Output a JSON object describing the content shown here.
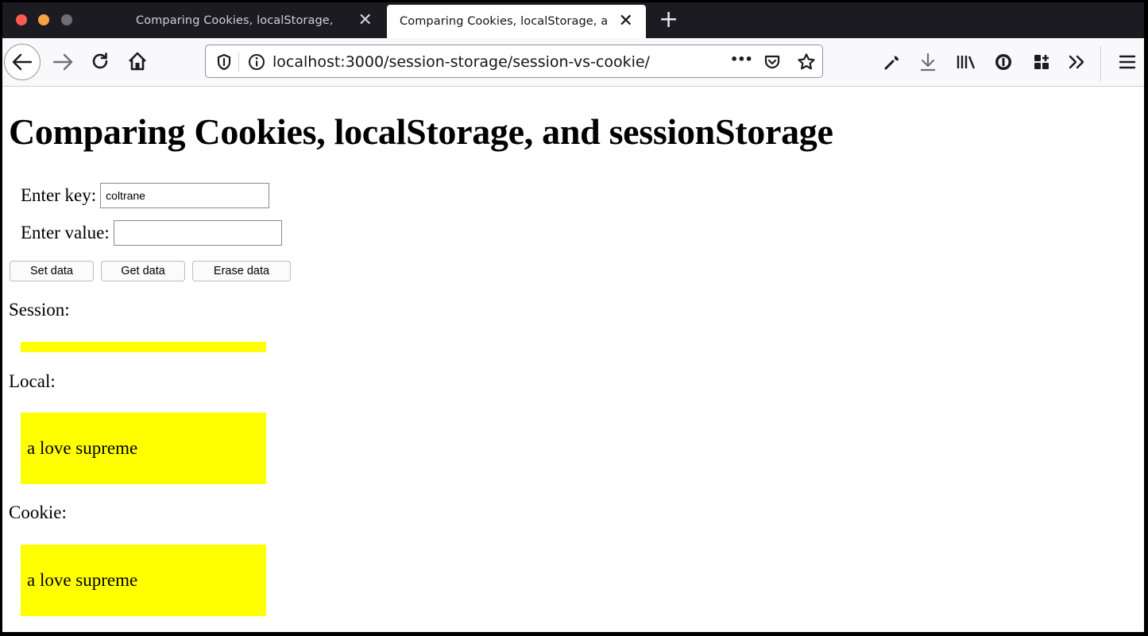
{
  "browser": {
    "tabs": [
      {
        "title": "Comparing Cookies, localStorage,",
        "active": false
      },
      {
        "title": "Comparing Cookies, localStorage, a",
        "active": true
      }
    ],
    "close_glyph": "✕",
    "new_tab_glyph": "+",
    "url": "localhost:3000/session-storage/session-vs-cookie/",
    "more_glyph": "•••",
    "icons": {
      "back": "back-arrow-icon",
      "forward": "forward-arrow-icon",
      "reload": "reload-icon",
      "home": "home-icon",
      "shield": "tracking-shield-icon",
      "info": "site-info-icon",
      "pocket": "pocket-icon",
      "bookmark": "bookmark-star-icon",
      "devtools": "wrench-icon",
      "downloads": "download-icon",
      "library": "library-icon",
      "extension": "extension-icon",
      "containers": "containers-icon",
      "overflow": "overflow-chevrons-icon",
      "menu": "hamburger-menu-icon"
    }
  },
  "page": {
    "title": "Comparing Cookies, localStorage, and sessionStorage",
    "key_label": "Enter key:",
    "key_value": "coltrane",
    "value_label": "Enter value:",
    "value_value": "",
    "buttons": {
      "set": "Set data",
      "get": "Get data",
      "erase": "Erase data"
    },
    "session_label": "Session:",
    "session_value": "",
    "local_label": "Local:",
    "local_value": "a love supreme",
    "cookie_label": "Cookie:",
    "cookie_value": "a love supreme",
    "highlight_color": "#ffff00"
  }
}
